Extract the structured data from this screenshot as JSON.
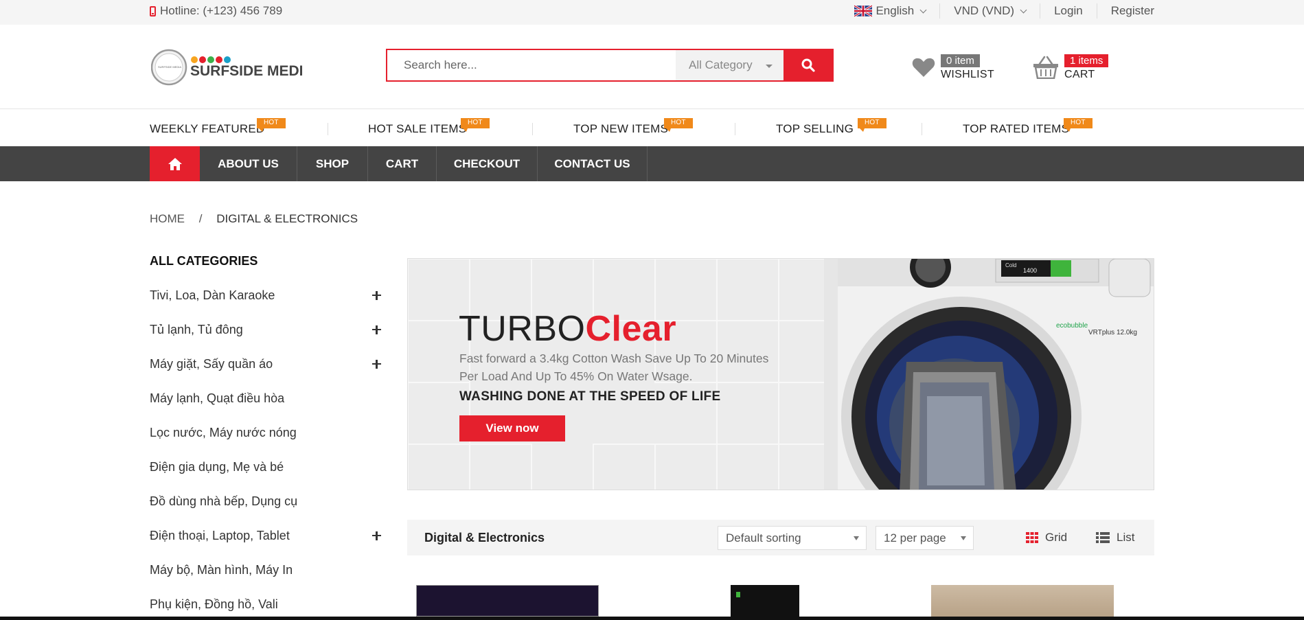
{
  "topbar": {
    "hotline": "Hotline: (+123) 456 789",
    "language": "English",
    "currency": "VND (VND)",
    "login": "Login",
    "register": "Register"
  },
  "header": {
    "logo_text": "SURFSIDE MEDIA",
    "logo_small": "SURFSIDE MEDIA",
    "search_placeholder": "Search here...",
    "search_category": "All Category",
    "wishlist_count": "0 item",
    "wishlist_label": "WISHLIST",
    "cart_count": "1 items",
    "cart_label": "CART"
  },
  "hot_links": [
    {
      "label": "WEEKLY FEATURED",
      "tag": "HOT"
    },
    {
      "label": "HOT SALE ITEMS",
      "tag": "HOT"
    },
    {
      "label": "TOP NEW ITEMS",
      "tag": "HOT"
    },
    {
      "label": "TOP SELLING",
      "tag": "HOT"
    },
    {
      "label": "TOP RATED ITEMS",
      "tag": "HOT"
    }
  ],
  "nav": {
    "items": [
      "ABOUT US",
      "SHOP",
      "CART",
      "CHECKOUT",
      "CONTACT US"
    ]
  },
  "breadcrumb": {
    "home": "HOME",
    "separator": "/",
    "current": "DIGITAL & ELECTRONICS"
  },
  "sidebar": {
    "title": "ALL CATEGORIES",
    "items": [
      {
        "label": "Tivi, Loa, Dàn Karaoke",
        "expandable": true
      },
      {
        "label": "Tủ lạnh, Tủ đông",
        "expandable": true
      },
      {
        "label": "Máy giặt, Sấy quần áo",
        "expandable": true
      },
      {
        "label": "Máy lạnh, Quạt điều hòa",
        "expandable": false
      },
      {
        "label": "Lọc nước, Máy nước nóng",
        "expandable": false
      },
      {
        "label": "Điện gia dụng, Mẹ và bé",
        "expandable": false
      },
      {
        "label": "Đồ dùng nhà bếp, Dụng cụ",
        "expandable": false
      },
      {
        "label": "Điện thoại, Laptop, Tablet",
        "expandable": true
      },
      {
        "label": "Máy bộ, Màn hình, Máy In",
        "expandable": false
      },
      {
        "label": "Phụ kiện, Đồng hồ, Vali",
        "expandable": false
      }
    ]
  },
  "banner": {
    "title_regular": "TURBO",
    "title_bold": "Clear",
    "desc_line1": "Fast forward a 3.4kg Cotton Wash Save Up To 20 Minutes",
    "desc_line2": "Per Load And Up To 45% On Water Wsage.",
    "tagline": "WASHING DONE AT THE SPEED OF LIFE",
    "button": "View now",
    "washer_brand": "ecobubble",
    "washer_model": "VRTplus 12.0kg",
    "washer_display": "1400",
    "washer_display_mode": "Cold"
  },
  "toolbar": {
    "title": "Digital & Electronics",
    "sort_selected": "Default sorting",
    "per_page_selected": "12 per page",
    "grid_label": "Grid",
    "list_label": "List"
  },
  "colors": {
    "accent": "#e5202d",
    "nav_bg": "#444444",
    "hot_tag": "#f0891a",
    "topbar_bg": "#f5f5f5"
  }
}
